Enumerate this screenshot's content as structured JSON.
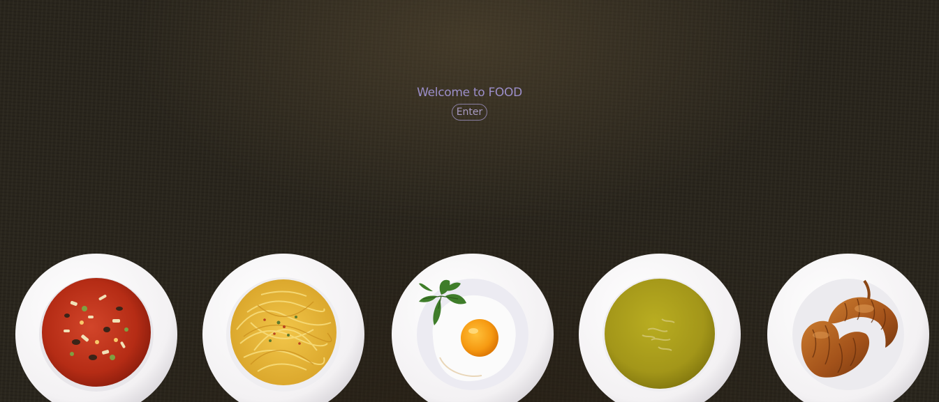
{
  "hero": {
    "title": "Welcome to FOOD",
    "enter_label": "Enter"
  },
  "plates": [
    {
      "dish": "minestrone-soup",
      "icon": "soup-bowl-icon"
    },
    {
      "dish": "spaghetti",
      "icon": "pasta-plate-icon"
    },
    {
      "dish": "fried-egg-with-basil",
      "icon": "egg-plate-icon"
    },
    {
      "dish": "pea-soup",
      "icon": "soup-bowl-icon"
    },
    {
      "dish": "croissants",
      "icon": "croissant-plate-icon"
    }
  ],
  "colors": {
    "background": "#27231a",
    "title": "#9b8ec9",
    "button_border": "#8a7fa4",
    "plate": "#ffffff"
  }
}
